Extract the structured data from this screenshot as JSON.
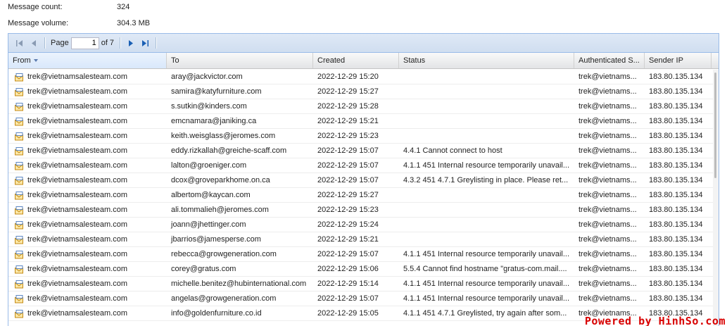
{
  "summary": {
    "count_label": "Message count:",
    "count_value": "324",
    "volume_label": "Message volume:",
    "volume_value": "304.3 MB"
  },
  "pager": {
    "page_label": "Page",
    "page_value": "1",
    "of_label": "of 7"
  },
  "columns": {
    "from": "From",
    "to": "To",
    "created": "Created",
    "status": "Status",
    "auth": "Authenticated S...",
    "ip": "Sender IP"
  },
  "rows": [
    {
      "from": "trek@vietnamsalesteam.com",
      "to": "aray@jackvictor.com",
      "created": "2022-12-29 15:20",
      "status": "",
      "auth": "trek@vietnams...",
      "ip": "183.80.135.134"
    },
    {
      "from": "trek@vietnamsalesteam.com",
      "to": "samira@katyfurniture.com",
      "created": "2022-12-29 15:27",
      "status": "",
      "auth": "trek@vietnams...",
      "ip": "183.80.135.134"
    },
    {
      "from": "trek@vietnamsalesteam.com",
      "to": "s.sutkin@kinders.com",
      "created": "2022-12-29 15:28",
      "status": "",
      "auth": "trek@vietnams...",
      "ip": "183.80.135.134"
    },
    {
      "from": "trek@vietnamsalesteam.com",
      "to": "emcnamara@janiking.ca",
      "created": "2022-12-29 15:21",
      "status": "",
      "auth": "trek@vietnams...",
      "ip": "183.80.135.134"
    },
    {
      "from": "trek@vietnamsalesteam.com",
      "to": "keith.weisglass@jeromes.com",
      "created": "2022-12-29 15:23",
      "status": "",
      "auth": "trek@vietnams...",
      "ip": "183.80.135.134"
    },
    {
      "from": "trek@vietnamsalesteam.com",
      "to": "eddy.rizkallah@greiche-scaff.com",
      "created": "2022-12-29 15:07",
      "status": "4.4.1 Cannot connect to host",
      "auth": "trek@vietnams...",
      "ip": "183.80.135.134"
    },
    {
      "from": "trek@vietnamsalesteam.com",
      "to": "lalton@groeniger.com",
      "created": "2022-12-29 15:07",
      "status": "4.1.1 451 Internal resource temporarily unavail...",
      "auth": "trek@vietnams...",
      "ip": "183.80.135.134"
    },
    {
      "from": "trek@vietnamsalesteam.com",
      "to": "dcox@groveparkhome.on.ca",
      "created": "2022-12-29 15:07",
      "status": "4.3.2 451 4.7.1 Greylisting in place. Please ret...",
      "auth": "trek@vietnams...",
      "ip": "183.80.135.134"
    },
    {
      "from": "trek@vietnamsalesteam.com",
      "to": "albertom@kaycan.com",
      "created": "2022-12-29 15:27",
      "status": "",
      "auth": "trek@vietnams...",
      "ip": "183.80.135.134"
    },
    {
      "from": "trek@vietnamsalesteam.com",
      "to": "ali.tommalieh@jeromes.com",
      "created": "2022-12-29 15:23",
      "status": "",
      "auth": "trek@vietnams...",
      "ip": "183.80.135.134"
    },
    {
      "from": "trek@vietnamsalesteam.com",
      "to": "joann@jhettinger.com",
      "created": "2022-12-29 15:24",
      "status": "",
      "auth": "trek@vietnams...",
      "ip": "183.80.135.134"
    },
    {
      "from": "trek@vietnamsalesteam.com",
      "to": "jbarrios@jamesperse.com",
      "created": "2022-12-29 15:21",
      "status": "",
      "auth": "trek@vietnams...",
      "ip": "183.80.135.134"
    },
    {
      "from": "trek@vietnamsalesteam.com",
      "to": "rebecca@growgeneration.com",
      "created": "2022-12-29 15:07",
      "status": "4.1.1 451 Internal resource temporarily unavail...",
      "auth": "trek@vietnams...",
      "ip": "183.80.135.134"
    },
    {
      "from": "trek@vietnamsalesteam.com",
      "to": "corey@gratus.com",
      "created": "2022-12-29 15:06",
      "status": "5.5.4 Cannot find hostname \"gratus-com.mail....",
      "auth": "trek@vietnams...",
      "ip": "183.80.135.134"
    },
    {
      "from": "trek@vietnamsalesteam.com",
      "to": "michelle.benitez@hubinternational.com",
      "created": "2022-12-29 15:14",
      "status": "4.1.1 451 Internal resource temporarily unavail...",
      "auth": "trek@vietnams...",
      "ip": "183.80.135.134"
    },
    {
      "from": "trek@vietnamsalesteam.com",
      "to": "angelas@growgeneration.com",
      "created": "2022-12-29 15:07",
      "status": "4.1.1 451 Internal resource temporarily unavail...",
      "auth": "trek@vietnams...",
      "ip": "183.80.135.134"
    },
    {
      "from": "trek@vietnamsalesteam.com",
      "to": "info@goldenfurniture.co.id",
      "created": "2022-12-29 15:05",
      "status": "4.1.1 451 4.7.1 Greylisted, try again after som...",
      "auth": "trek@vietnams...",
      "ip": "183.80.135.134"
    }
  ],
  "watermark": "Powered by HinhSo.com"
}
